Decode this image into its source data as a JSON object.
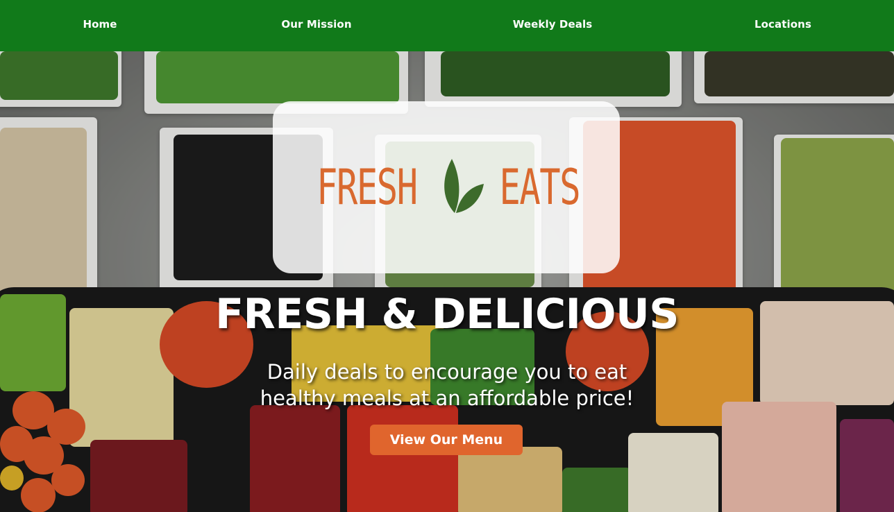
{
  "nav": {
    "home": "Home",
    "mission": "Our Mission",
    "deals": "Weekly Deals",
    "locations": "Locations"
  },
  "logo": {
    "word_left": "FRESH",
    "word_right": "EATS",
    "icon": "leaf-icon"
  },
  "hero": {
    "headline": "FRESH & DELICIOUS",
    "subline_1": "Daily deals to encourage you to eat",
    "subline_2": "healthy meals at an affordable price!",
    "cta_label": "View Our Menu",
    "background": "salad-bar-photo"
  },
  "colors": {
    "nav_bg": "#117a1a",
    "accent": "#e0652d",
    "logo_text": "#d9692f",
    "leaf": "#3d6b2b"
  }
}
